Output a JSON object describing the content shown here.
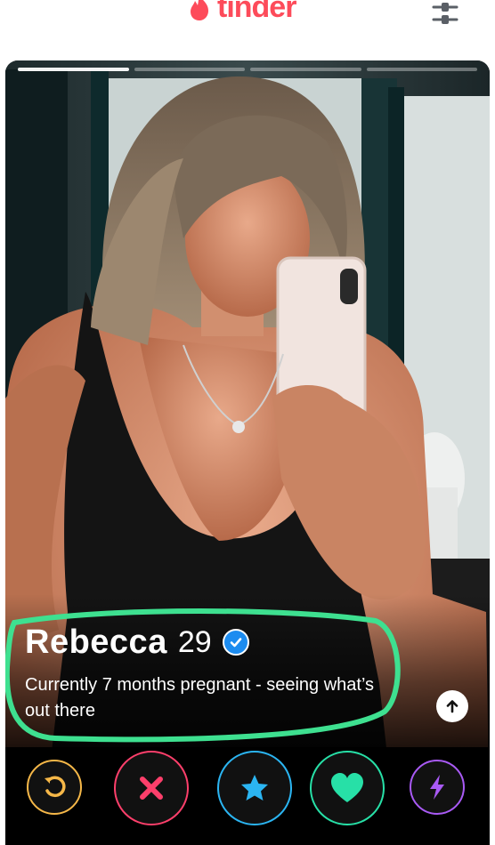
{
  "header": {
    "logo_text": "tinder",
    "logo_icon": "flame-icon",
    "filter_icon": "sliders-icon"
  },
  "profile": {
    "name": "Rebecca",
    "age": "29",
    "verified_icon": "verified-check-icon",
    "bio": "Currently 7 months pregnant - seeing what’s out there",
    "photo_count": 4,
    "active_photo_index": 0,
    "info_icon": "arrow-up-icon"
  },
  "actions": [
    {
      "name": "rewind-button",
      "icon": "rewind-icon",
      "color": "#f5b748"
    },
    {
      "name": "nope-button",
      "icon": "x-icon",
      "color": "#fd3f6b"
    },
    {
      "name": "super-like-button",
      "icon": "star-icon",
      "color": "#2bb5f2"
    },
    {
      "name": "like-button",
      "icon": "heart-icon",
      "color": "#27e0a7"
    },
    {
      "name": "boost-button",
      "icon": "bolt-icon",
      "color": "#a95af5"
    }
  ],
  "colors": {
    "brand": "#fd4b5a",
    "annotation": "#3ee090"
  }
}
